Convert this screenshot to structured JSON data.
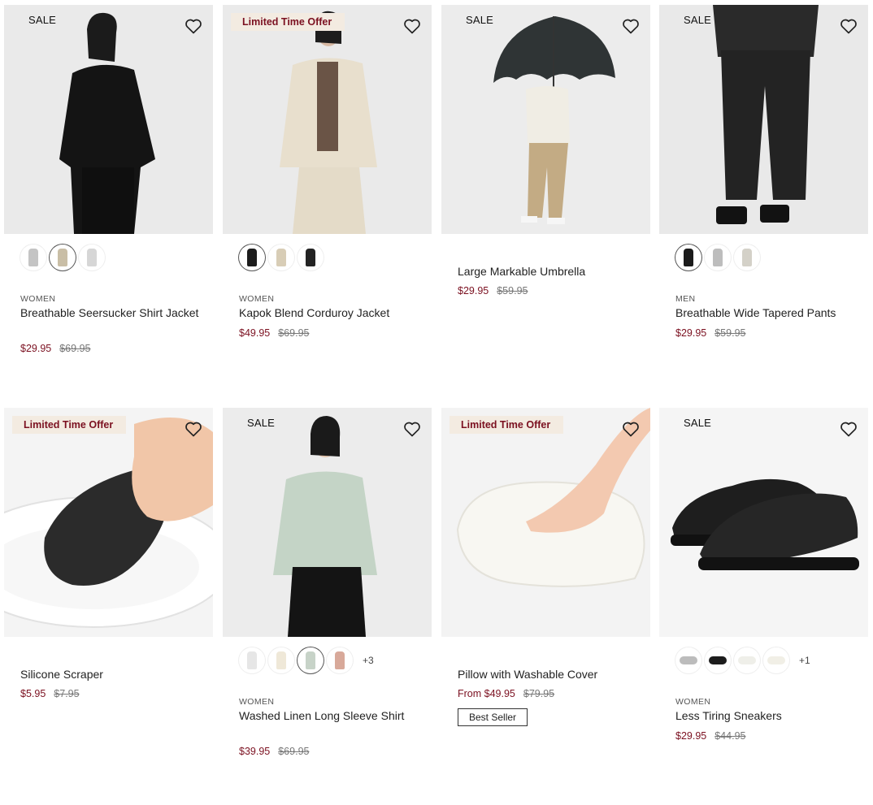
{
  "products": [
    {
      "badge": "SALE",
      "category": "WOMEN",
      "name": "Breathable Seersucker Shirt Jacket",
      "price": "$29.95",
      "was": "$69.95",
      "image": "black seersucker shirt jacket on model"
    },
    {
      "badge": "Limited Time Offer",
      "category": "WOMEN",
      "name": "Kapok Blend Corduroy Jacket",
      "price": "$49.95",
      "was": "$69.95",
      "image": "beige corduroy jacket on model"
    },
    {
      "badge": "SALE",
      "category": "",
      "name": "Large Markable Umbrella",
      "price": "$29.95",
      "was": "$59.95",
      "image": "person holding black umbrella"
    },
    {
      "badge": "SALE",
      "category": "MEN",
      "name": "Breathable Wide Tapered Pants",
      "price": "$29.95",
      "was": "$59.95",
      "image": "black tapered pants on model"
    },
    {
      "badge": "Limited Time Offer",
      "category": "",
      "name": "Silicone Scraper",
      "price": "$5.95",
      "was": "$7.95",
      "image": "silicone scraper on white plate"
    },
    {
      "badge": "SALE",
      "category": "WOMEN",
      "name": "Washed Linen Long Sleeve Shirt",
      "price": "$39.95",
      "was": "$69.95",
      "more": "+3",
      "image": "sage green linen shirt on model"
    },
    {
      "badge": "Limited Time Offer",
      "category": "",
      "name": "Pillow with Washable Cover",
      "price": "From $49.95",
      "was": "$79.95",
      "tag": "Best Seller",
      "image": "white pillow pressed by hand"
    },
    {
      "badge": "SALE",
      "category": "WOMEN",
      "name": "Less Tiring Sneakers",
      "price": "$29.95",
      "was": "$44.95",
      "more": "+1",
      "image": "black low-top sneakers"
    }
  ],
  "colors": {
    "sale_price": "#7b1020",
    "badge_bg": "#f3ebe1",
    "strike": "#777777"
  },
  "icons": {
    "wishlist": "heart-outline-icon"
  }
}
